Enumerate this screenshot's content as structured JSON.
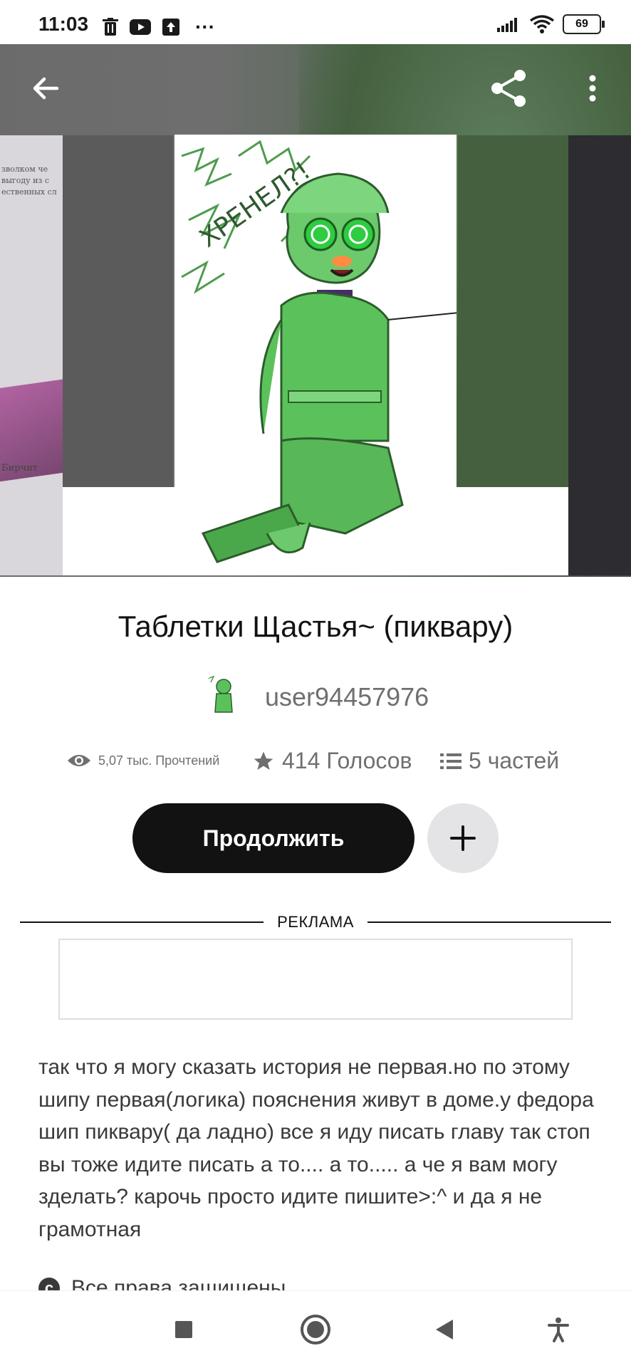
{
  "status_bar": {
    "time": "11:03",
    "more": "···",
    "battery": "69",
    "icons": [
      "trash-icon",
      "youtube-icon",
      "upload-icon",
      "signal-icon",
      "wifi-icon",
      "battery-icon"
    ]
  },
  "top_nav": {
    "icons": [
      "back-arrow-icon",
      "share-icon",
      "more-vertical-icon"
    ]
  },
  "side_cover_left": {
    "lines": [
      "зволком че",
      "выгоду из с",
      "ественных сл"
    ],
    "author": "Бирчит"
  },
  "cover": {
    "scrawl": "ХРЕНЕЛ?!"
  },
  "story": {
    "title": "Таблетки Щастья~ (пиквару)",
    "author": "user94457976",
    "reads": "5,07 тыс. Прочтений",
    "votes": "414 Голосов",
    "parts": "5 частей",
    "description": "так что я могу сказать история не первая.но по этому шипу первая(логика) пояснения живут в доме.у федора  шип пиквару( да ладно) все я иду писать главу так стоп вы тоже идите писать а то.... а то..... а че я вам могу зделать? карочь просто идите пишите>:^ и да я не грамотная",
    "rights": "Все права защищены"
  },
  "actions": {
    "continue_label": "Продолжить"
  },
  "ad": {
    "label": "РЕКЛАМА"
  },
  "nav_bar": {
    "icons": [
      "recents-square-icon",
      "home-circle-icon",
      "back-triangle-icon",
      "accessibility-icon"
    ]
  },
  "colors": {
    "primary_text": "#121212",
    "secondary_text": "#6f6f6f",
    "button_dark": "#121212",
    "button_light": "#e4e3e6",
    "character_green": "#5bc25b"
  }
}
